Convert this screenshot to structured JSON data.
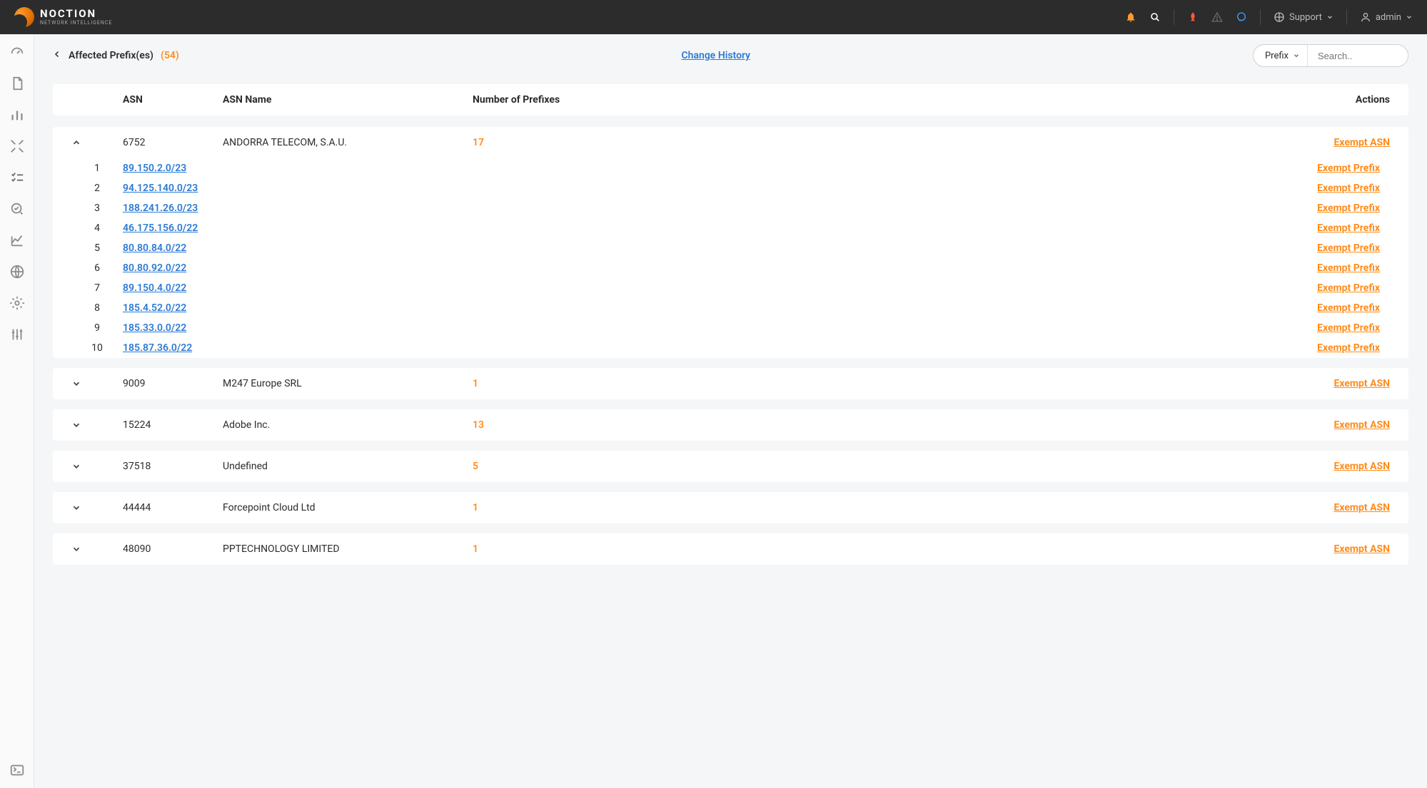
{
  "brand": {
    "name": "NOCTION",
    "tagline": "NETWORK INTELLIGENCE"
  },
  "topbar": {
    "support_label": "Support",
    "user_label": "admin"
  },
  "page": {
    "title": "Affected Prefix(es)",
    "count_label": "(54)",
    "history_link": "Change History",
    "filter_selected": "Prefix",
    "search_placeholder": "Search.."
  },
  "columns": {
    "asn": "ASN",
    "asn_name": "ASN Name",
    "num_prefixes": "Number of Prefixes",
    "actions": "Actions"
  },
  "labels": {
    "exempt_asn": "Exempt ASN",
    "exempt_prefix": "Exempt Prefix"
  },
  "groups": [
    {
      "asn": "6752",
      "name": "ANDORRA TELECOM, S.A.U.",
      "count": "17",
      "expanded": true,
      "prefixes": [
        "89.150.2.0/23",
        "94.125.140.0/23",
        "188.241.26.0/23",
        "46.175.156.0/22",
        "80.80.84.0/22",
        "80.80.92.0/22",
        "89.150.4.0/22",
        "185.4.52.0/22",
        "185.33.0.0/22",
        "185.87.36.0/22"
      ]
    },
    {
      "asn": "9009",
      "name": "M247 Europe SRL",
      "count": "1",
      "expanded": false
    },
    {
      "asn": "15224",
      "name": "Adobe Inc.",
      "count": "13",
      "expanded": false
    },
    {
      "asn": "37518",
      "name": "Undefined",
      "count": "5",
      "expanded": false
    },
    {
      "asn": "44444",
      "name": "Forcepoint Cloud Ltd",
      "count": "1",
      "expanded": false
    },
    {
      "asn": "48090",
      "name": "PPTECHNOLOGY LIMITED",
      "count": "1",
      "expanded": false
    }
  ]
}
